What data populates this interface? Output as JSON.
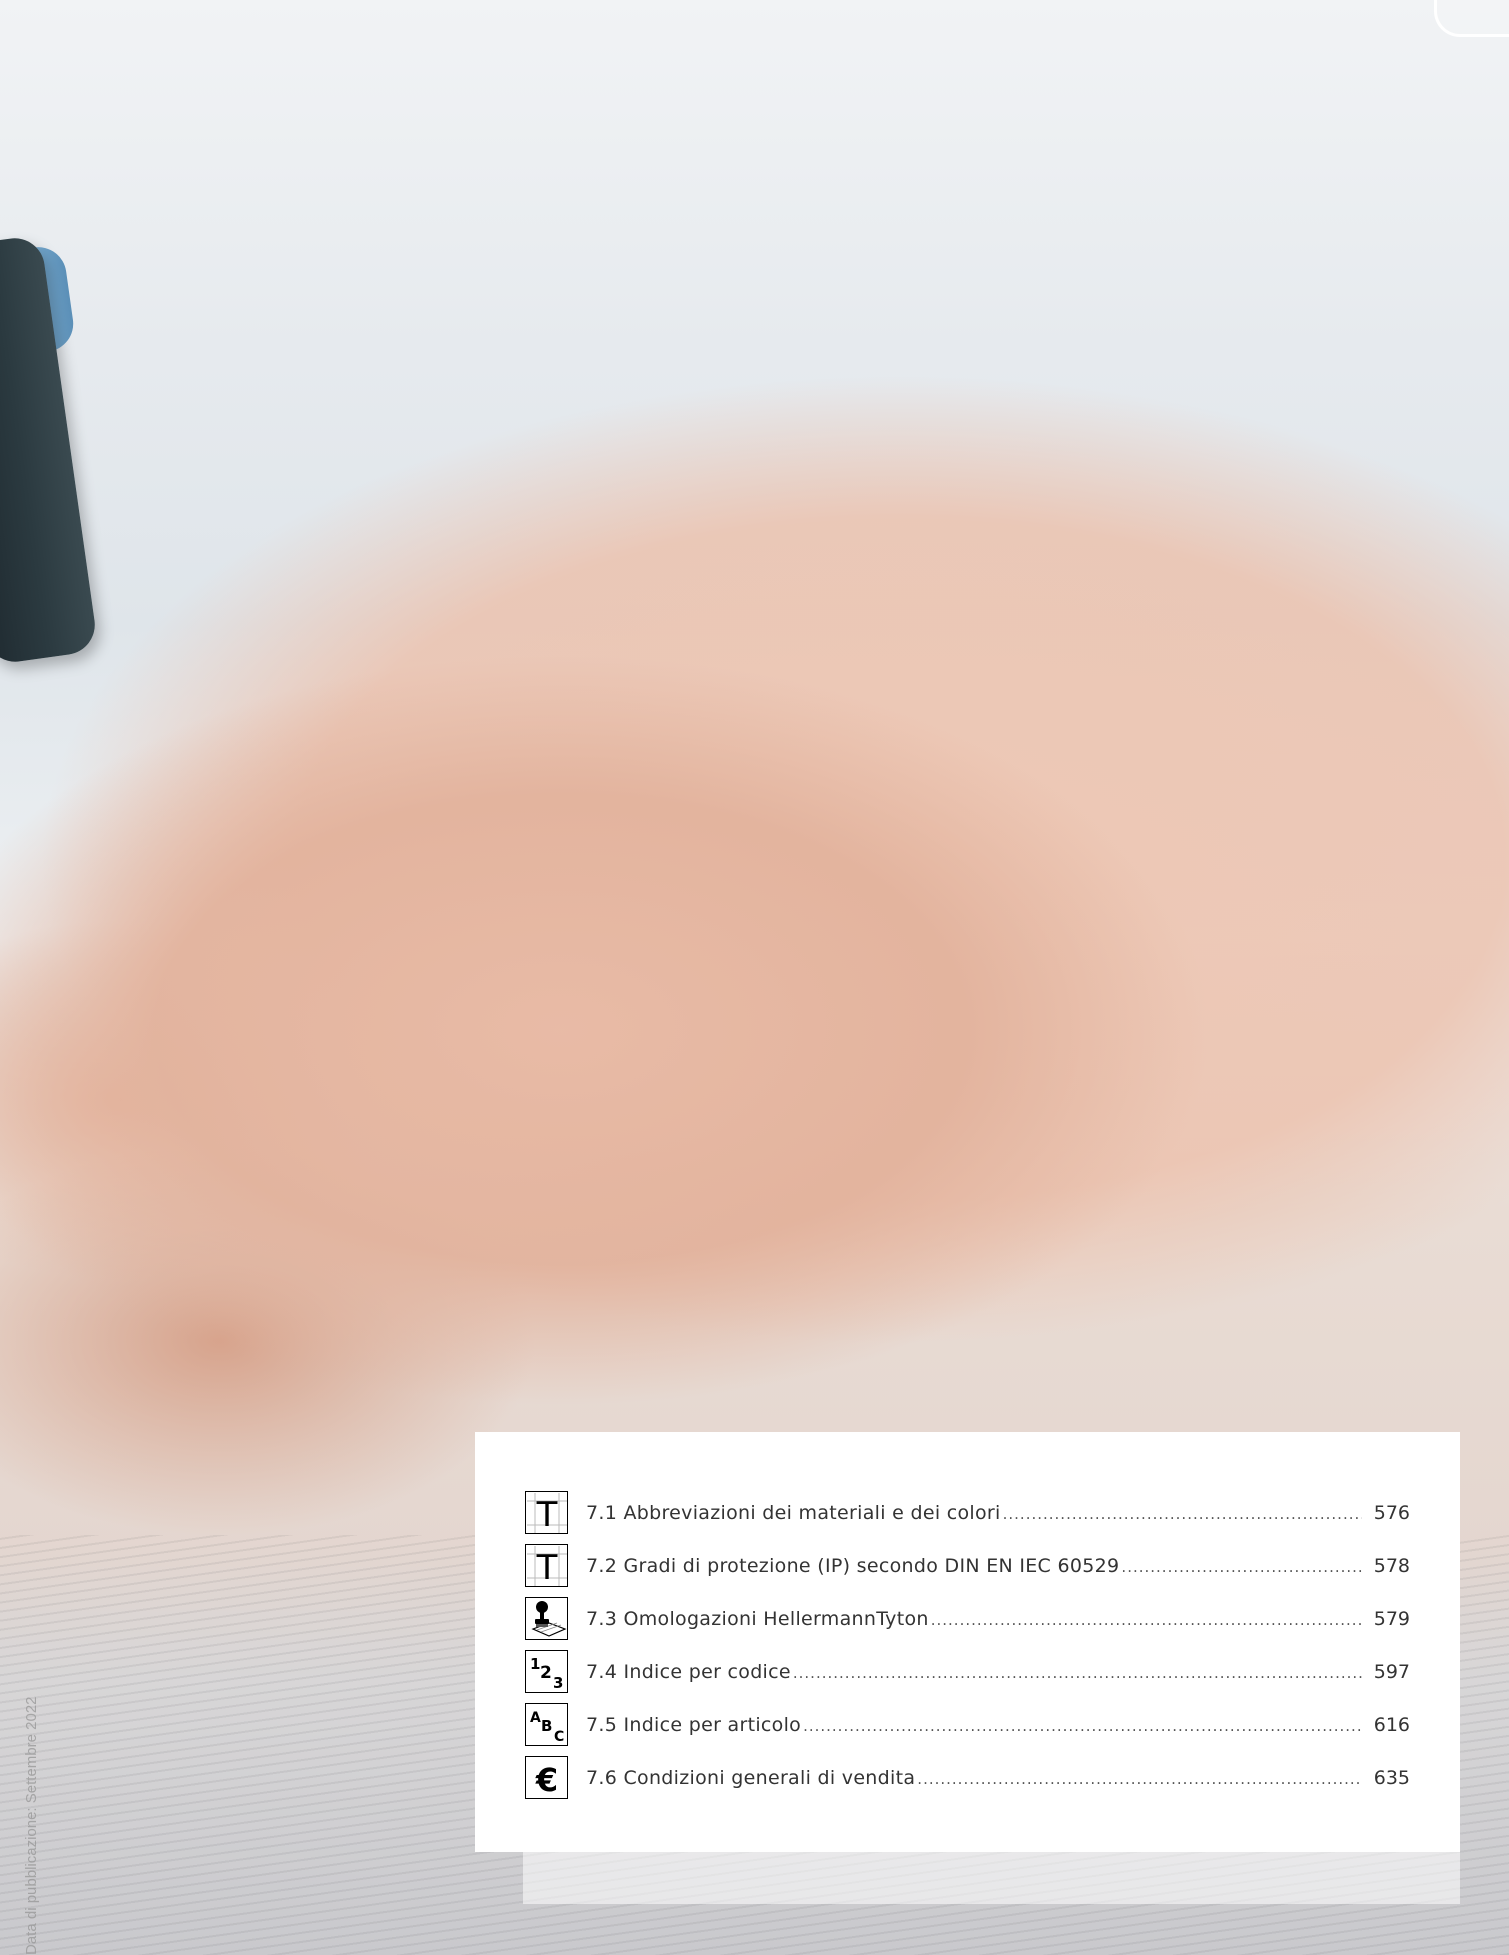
{
  "side_note": "Data di pubblicazione: Settembre 2022",
  "toc": {
    "items": [
      {
        "icon": "table-t-icon",
        "label": "7.1 Abbreviazioni dei materiali e dei colori",
        "page": "576"
      },
      {
        "icon": "table-t-icon",
        "label": "7.2 Gradi di protezione (IP) secondo DIN EN IEC 60529",
        "page": "578"
      },
      {
        "icon": "stamp-approval-icon",
        "label": "7.3 Omologazioni HellermannTyton",
        "page": "579"
      },
      {
        "icon": "numeric-index-icon",
        "label": "7.4 Indice per codice",
        "page": "597"
      },
      {
        "icon": "alphabetical-index-icon",
        "label": "7.5 Indice per articolo",
        "page": "616"
      },
      {
        "icon": "euro-icon",
        "label": "7.6 Condizioni generali di vendita",
        "page": "635"
      }
    ]
  }
}
